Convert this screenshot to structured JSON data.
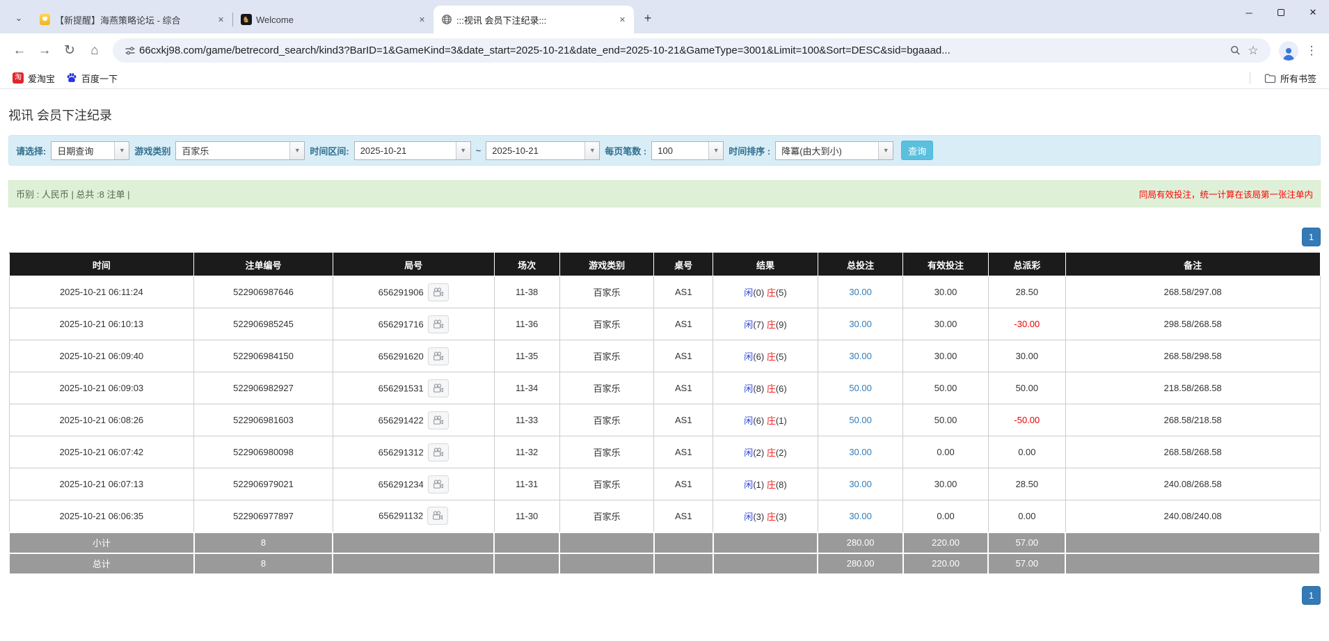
{
  "browser": {
    "tab_search_glyph": "⌄",
    "tabs": [
      {
        "title": "【新提醒】海燕策略论坛 - 综合",
        "close": "✕"
      },
      {
        "title": "Welcome",
        "close": "✕"
      },
      {
        "title": ":::视讯 会员下注纪录:::",
        "close": "✕"
      }
    ],
    "new_tab_glyph": "+",
    "window": {
      "minimize": "─",
      "close": "✕"
    },
    "nav": {
      "back": "←",
      "forward": "→",
      "reload": "↻",
      "home": "⌂"
    },
    "url": "66cxkj98.com/game/betrecord_search/kind3?BarID=1&GameKind=3&date_start=2025-10-21&date_end=2025-10-21&GameType=3001&Limit=100&Sort=DESC&sid=bgaaad...",
    "star_glyph": "☆",
    "menu_glyph": "⋮",
    "bookmarks": [
      {
        "label": "爱淘宝",
        "icon_text": "淘"
      },
      {
        "label": "百度一下"
      }
    ],
    "all_bookmarks_label": "所有书签"
  },
  "page": {
    "title": "视讯 会员下注纪录",
    "filters": {
      "select_label": "请选择:",
      "select_value": "日期查询",
      "game_kind_label": "游戏类别",
      "game_kind_value": "百家乐",
      "date_range_label": "时间区间:",
      "date_start": "2025-10-21",
      "date_separator": "~",
      "date_end": "2025-10-21",
      "page_size_label": "每页笔数 :",
      "page_size_value": "100",
      "sort_label": "时间排序 :",
      "sort_value": "降冪(由大到小)",
      "search_button": "查询",
      "dropdown_glyph": "▼"
    },
    "summary_bar": {
      "left": "币别 : 人民币 | 总共 :8 注单 |",
      "right": "同局有效投注，统一计算在该局第一张注单内"
    },
    "pagination": {
      "page": "1"
    },
    "colors": {
      "accent_blue": "#337ab7",
      "player_blue": "#2b46e6",
      "banker_red": "#ee2222",
      "negative_red": "#e60000",
      "panel_info": "#d9edf7",
      "panel_success": "#dff0d8",
      "header_black": "#1b1b1b",
      "summary_gray": "#9a9a9a",
      "search_btn": "#5bc0de"
    },
    "table": {
      "headers": [
        "时间",
        "注单编号",
        "局号",
        "场次",
        "游戏类别",
        "桌号",
        "结果",
        "总投注",
        "有效投注",
        "总派彩",
        "备注"
      ],
      "rows": [
        {
          "time": "2025-10-21 06:11:24",
          "bet_id": "522906987646",
          "round": "656291906",
          "session": "11-38",
          "game": "百家乐",
          "table_no": "AS1",
          "result": {
            "player": "闲",
            "player_n": "(0)",
            "banker": "庄",
            "banker_n": "(5)"
          },
          "total_bet": "30.00",
          "valid_bet": "30.00",
          "payout": "28.50",
          "note": "268.58/297.08"
        },
        {
          "time": "2025-10-21 06:10:13",
          "bet_id": "522906985245",
          "round": "656291716",
          "session": "11-36",
          "game": "百家乐",
          "table_no": "AS1",
          "result": {
            "player": "闲",
            "player_n": "(7)",
            "banker": "庄",
            "banker_n": "(9)"
          },
          "total_bet": "30.00",
          "valid_bet": "30.00",
          "payout": "-30.00",
          "note": "298.58/268.58"
        },
        {
          "time": "2025-10-21 06:09:40",
          "bet_id": "522906984150",
          "round": "656291620",
          "session": "11-35",
          "game": "百家乐",
          "table_no": "AS1",
          "result": {
            "player": "闲",
            "player_n": "(6)",
            "banker": "庄",
            "banker_n": "(5)"
          },
          "total_bet": "30.00",
          "valid_bet": "30.00",
          "payout": "30.00",
          "note": "268.58/298.58"
        },
        {
          "time": "2025-10-21 06:09:03",
          "bet_id": "522906982927",
          "round": "656291531",
          "session": "11-34",
          "game": "百家乐",
          "table_no": "AS1",
          "result": {
            "player": "闲",
            "player_n": "(8)",
            "banker": "庄",
            "banker_n": "(6)"
          },
          "total_bet": "50.00",
          "valid_bet": "50.00",
          "payout": "50.00",
          "note": "218.58/268.58"
        },
        {
          "time": "2025-10-21 06:08:26",
          "bet_id": "522906981603",
          "round": "656291422",
          "session": "11-33",
          "game": "百家乐",
          "table_no": "AS1",
          "result": {
            "player": "闲",
            "player_n": "(6)",
            "banker": "庄",
            "banker_n": "(1)"
          },
          "total_bet": "50.00",
          "valid_bet": "50.00",
          "payout": "-50.00",
          "note": "268.58/218.58"
        },
        {
          "time": "2025-10-21 06:07:42",
          "bet_id": "522906980098",
          "round": "656291312",
          "session": "11-32",
          "game": "百家乐",
          "table_no": "AS1",
          "result": {
            "player": "闲",
            "player_n": "(2)",
            "banker": "庄",
            "banker_n": "(2)"
          },
          "total_bet": "30.00",
          "valid_bet": "0.00",
          "payout": "0.00",
          "note": "268.58/268.58"
        },
        {
          "time": "2025-10-21 06:07:13",
          "bet_id": "522906979021",
          "round": "656291234",
          "session": "11-31",
          "game": "百家乐",
          "table_no": "AS1",
          "result": {
            "player": "闲",
            "player_n": "(1)",
            "banker": "庄",
            "banker_n": "(8)"
          },
          "total_bet": "30.00",
          "valid_bet": "30.00",
          "payout": "28.50",
          "note": "240.08/268.58"
        },
        {
          "time": "2025-10-21 06:06:35",
          "bet_id": "522906977897",
          "round": "656291132",
          "session": "11-30",
          "game": "百家乐",
          "table_no": "AS1",
          "result": {
            "player": "闲",
            "player_n": "(3)",
            "banker": "庄",
            "banker_n": "(3)"
          },
          "total_bet": "30.00",
          "valid_bet": "0.00",
          "payout": "0.00",
          "note": "240.08/240.08"
        }
      ],
      "subtotal": {
        "label": "小计",
        "count": "8",
        "total_bet": "280.00",
        "valid_bet": "220.00",
        "payout": "57.00"
      },
      "total": {
        "label": "总计",
        "count": "8",
        "total_bet": "280.00",
        "valid_bet": "220.00",
        "payout": "57.00"
      }
    }
  }
}
